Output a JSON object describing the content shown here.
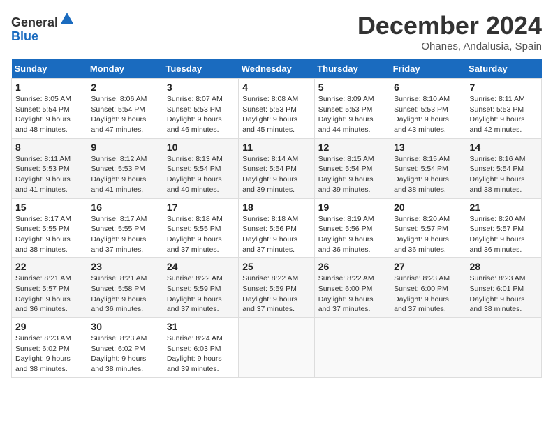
{
  "header": {
    "logo_general": "General",
    "logo_blue": "Blue",
    "month_title": "December 2024",
    "location": "Ohanes, Andalusia, Spain"
  },
  "calendar": {
    "days_of_week": [
      "Sunday",
      "Monday",
      "Tuesday",
      "Wednesday",
      "Thursday",
      "Friday",
      "Saturday"
    ],
    "weeks": [
      [
        {
          "day": "",
          "empty": true
        },
        {
          "day": "",
          "empty": true
        },
        {
          "day": "",
          "empty": true
        },
        {
          "day": "",
          "empty": true
        },
        {
          "day": "",
          "empty": true
        },
        {
          "day": "",
          "empty": true
        },
        {
          "day": "",
          "empty": true
        }
      ],
      [
        {
          "day": "1",
          "sunrise": "8:05 AM",
          "sunset": "5:54 PM",
          "daylight": "9 hours and 48 minutes."
        },
        {
          "day": "2",
          "sunrise": "8:06 AM",
          "sunset": "5:54 PM",
          "daylight": "9 hours and 47 minutes."
        },
        {
          "day": "3",
          "sunrise": "8:07 AM",
          "sunset": "5:53 PM",
          "daylight": "9 hours and 46 minutes."
        },
        {
          "day": "4",
          "sunrise": "8:08 AM",
          "sunset": "5:53 PM",
          "daylight": "9 hours and 45 minutes."
        },
        {
          "day": "5",
          "sunrise": "8:09 AM",
          "sunset": "5:53 PM",
          "daylight": "9 hours and 44 minutes."
        },
        {
          "day": "6",
          "sunrise": "8:10 AM",
          "sunset": "5:53 PM",
          "daylight": "9 hours and 43 minutes."
        },
        {
          "day": "7",
          "sunrise": "8:11 AM",
          "sunset": "5:53 PM",
          "daylight": "9 hours and 42 minutes."
        }
      ],
      [
        {
          "day": "8",
          "sunrise": "8:11 AM",
          "sunset": "5:53 PM",
          "daylight": "9 hours and 41 minutes."
        },
        {
          "day": "9",
          "sunrise": "8:12 AM",
          "sunset": "5:53 PM",
          "daylight": "9 hours and 41 minutes."
        },
        {
          "day": "10",
          "sunrise": "8:13 AM",
          "sunset": "5:54 PM",
          "daylight": "9 hours and 40 minutes."
        },
        {
          "day": "11",
          "sunrise": "8:14 AM",
          "sunset": "5:54 PM",
          "daylight": "9 hours and 39 minutes."
        },
        {
          "day": "12",
          "sunrise": "8:15 AM",
          "sunset": "5:54 PM",
          "daylight": "9 hours and 39 minutes."
        },
        {
          "day": "13",
          "sunrise": "8:15 AM",
          "sunset": "5:54 PM",
          "daylight": "9 hours and 38 minutes."
        },
        {
          "day": "14",
          "sunrise": "8:16 AM",
          "sunset": "5:54 PM",
          "daylight": "9 hours and 38 minutes."
        }
      ],
      [
        {
          "day": "15",
          "sunrise": "8:17 AM",
          "sunset": "5:55 PM",
          "daylight": "9 hours and 38 minutes."
        },
        {
          "day": "16",
          "sunrise": "8:17 AM",
          "sunset": "5:55 PM",
          "daylight": "9 hours and 37 minutes."
        },
        {
          "day": "17",
          "sunrise": "8:18 AM",
          "sunset": "5:55 PM",
          "daylight": "9 hours and 37 minutes."
        },
        {
          "day": "18",
          "sunrise": "8:18 AM",
          "sunset": "5:56 PM",
          "daylight": "9 hours and 37 minutes."
        },
        {
          "day": "19",
          "sunrise": "8:19 AM",
          "sunset": "5:56 PM",
          "daylight": "9 hours and 36 minutes."
        },
        {
          "day": "20",
          "sunrise": "8:20 AM",
          "sunset": "5:57 PM",
          "daylight": "9 hours and 36 minutes."
        },
        {
          "day": "21",
          "sunrise": "8:20 AM",
          "sunset": "5:57 PM",
          "daylight": "9 hours and 36 minutes."
        }
      ],
      [
        {
          "day": "22",
          "sunrise": "8:21 AM",
          "sunset": "5:57 PM",
          "daylight": "9 hours and 36 minutes."
        },
        {
          "day": "23",
          "sunrise": "8:21 AM",
          "sunset": "5:58 PM",
          "daylight": "9 hours and 36 minutes."
        },
        {
          "day": "24",
          "sunrise": "8:22 AM",
          "sunset": "5:59 PM",
          "daylight": "9 hours and 37 minutes."
        },
        {
          "day": "25",
          "sunrise": "8:22 AM",
          "sunset": "5:59 PM",
          "daylight": "9 hours and 37 minutes."
        },
        {
          "day": "26",
          "sunrise": "8:22 AM",
          "sunset": "6:00 PM",
          "daylight": "9 hours and 37 minutes."
        },
        {
          "day": "27",
          "sunrise": "8:23 AM",
          "sunset": "6:00 PM",
          "daylight": "9 hours and 37 minutes."
        },
        {
          "day": "28",
          "sunrise": "8:23 AM",
          "sunset": "6:01 PM",
          "daylight": "9 hours and 38 minutes."
        }
      ],
      [
        {
          "day": "29",
          "sunrise": "8:23 AM",
          "sunset": "6:02 PM",
          "daylight": "9 hours and 38 minutes."
        },
        {
          "day": "30",
          "sunrise": "8:23 AM",
          "sunset": "6:02 PM",
          "daylight": "9 hours and 38 minutes."
        },
        {
          "day": "31",
          "sunrise": "8:24 AM",
          "sunset": "6:03 PM",
          "daylight": "9 hours and 39 minutes."
        },
        {
          "day": "",
          "empty": true
        },
        {
          "day": "",
          "empty": true
        },
        {
          "day": "",
          "empty": true
        },
        {
          "day": "",
          "empty": true
        }
      ]
    ]
  }
}
